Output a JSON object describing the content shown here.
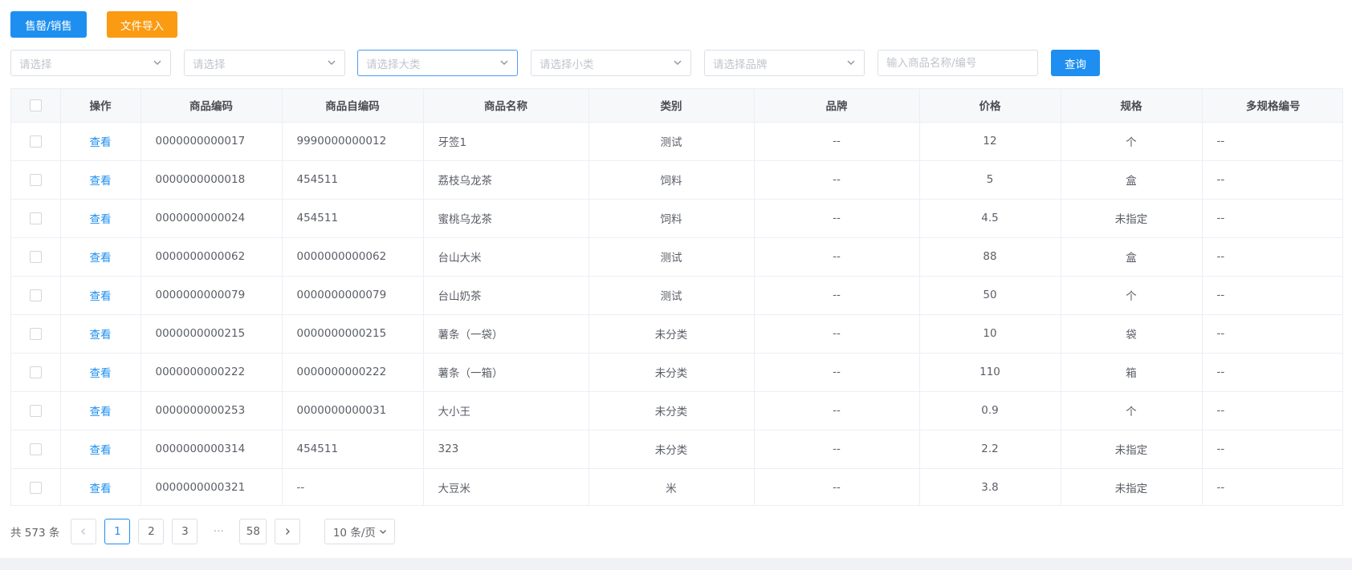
{
  "toolbar": {
    "sale_label": "售罄/销售",
    "import_label": "文件导入",
    "colors": {
      "primary": "#1e8ff0",
      "warning": "#fa9b12"
    }
  },
  "filters": {
    "select1_placeholder": "请选择",
    "select2_placeholder": "请选择",
    "category_placeholder": "请选择大类",
    "subcategory_placeholder": "请选择小类",
    "brand_placeholder": "请选择品牌",
    "search_placeholder": "输入商品名称/编号",
    "query_label": "查询"
  },
  "table": {
    "headers": [
      "操作",
      "商品编码",
      "商品自编码",
      "商品名称",
      "类别",
      "品牌",
      "价格",
      "规格",
      "多规格编号"
    ],
    "action_label": "查看",
    "rows": [
      {
        "code": "0000000000017",
        "self_code": "9990000000012",
        "name": "牙签1",
        "category": "测试",
        "brand": "--",
        "price": "12",
        "spec": "个",
        "multi_spec": "--"
      },
      {
        "code": "0000000000018",
        "self_code": "454511",
        "name": "荔枝乌龙茶",
        "category": "饲料",
        "brand": "--",
        "price": "5",
        "spec": "盒",
        "multi_spec": "--"
      },
      {
        "code": "0000000000024",
        "self_code": "454511",
        "name": "蜜桃乌龙茶",
        "category": "饲料",
        "brand": "--",
        "price": "4.5",
        "spec": "未指定",
        "multi_spec": "--"
      },
      {
        "code": "0000000000062",
        "self_code": "0000000000062",
        "name": "台山大米",
        "category": "测试",
        "brand": "--",
        "price": "88",
        "spec": "盒",
        "multi_spec": "--"
      },
      {
        "code": "0000000000079",
        "self_code": "0000000000079",
        "name": "台山奶茶",
        "category": "测试",
        "brand": "--",
        "price": "50",
        "spec": "个",
        "multi_spec": "--"
      },
      {
        "code": "0000000000215",
        "self_code": "0000000000215",
        "name": "薯条（一袋）",
        "category": "未分类",
        "brand": "--",
        "price": "10",
        "spec": "袋",
        "multi_spec": "--"
      },
      {
        "code": "0000000000222",
        "self_code": "0000000000222",
        "name": "薯条（一箱）",
        "category": "未分类",
        "brand": "--",
        "price": "110",
        "spec": "箱",
        "multi_spec": "--"
      },
      {
        "code": "0000000000253",
        "self_code": "0000000000031",
        "name": "大小王",
        "category": "未分类",
        "brand": "--",
        "price": "0.9",
        "spec": "个",
        "multi_spec": "--"
      },
      {
        "code": "0000000000314",
        "self_code": "454511",
        "name": "323",
        "category": "未分类",
        "brand": "--",
        "price": "2.2",
        "spec": "未指定",
        "multi_spec": "--"
      },
      {
        "code": "0000000000321",
        "self_code": "--",
        "name": "大豆米",
        "category": "米",
        "brand": "--",
        "price": "3.8",
        "spec": "未指定",
        "multi_spec": "--"
      }
    ]
  },
  "pagination": {
    "total_text": "共 573 条",
    "pages": [
      "1",
      "2",
      "3"
    ],
    "ellipsis": "···",
    "last_page": "58",
    "page_size": "10 条/页",
    "current": "1"
  }
}
